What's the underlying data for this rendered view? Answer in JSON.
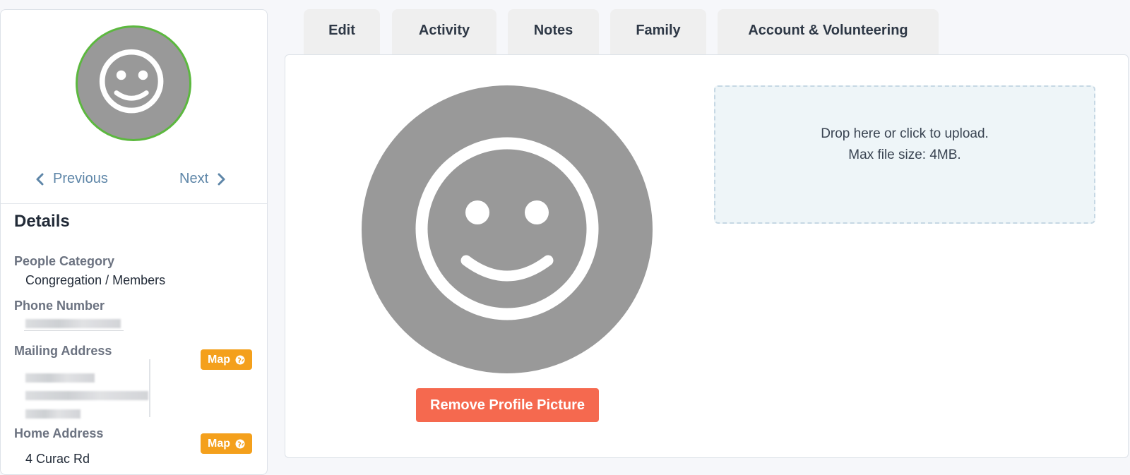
{
  "sidebar": {
    "pager": {
      "previous_label": "Previous",
      "next_label": "Next"
    },
    "details_title": "Details",
    "fields": {
      "people_category": {
        "label": "People Category",
        "value": "Congregation / Members"
      },
      "phone_number": {
        "label": "Phone Number"
      },
      "mailing_address": {
        "label": "Mailing Address",
        "map_label": "Map"
      },
      "home_address": {
        "label": "Home Address",
        "map_label": "Map",
        "value_partial": "4 Curac Rd"
      }
    }
  },
  "tabs": [
    {
      "label": "Edit"
    },
    {
      "label": "Activity"
    },
    {
      "label": "Notes"
    },
    {
      "label": "Family"
    },
    {
      "label": "Account & Volunteering"
    }
  ],
  "main": {
    "remove_button_label": "Remove Profile Picture",
    "dropzone": {
      "line1": "Drop here or click to upload.",
      "line2": "Max file size: 4MB."
    }
  },
  "icons": {
    "avatar": "smiley-face-icon",
    "previous": "chevron-left-icon",
    "next": "chevron-right-icon",
    "map": "globe-icon"
  },
  "colors": {
    "avatar_ring": "#5cb83f",
    "avatar_fill": "#999999",
    "map_button": "#f4a01c",
    "remove_button": "#f5694f",
    "pager_link": "#5e86a8",
    "dropzone_bg": "#eef5f8"
  }
}
